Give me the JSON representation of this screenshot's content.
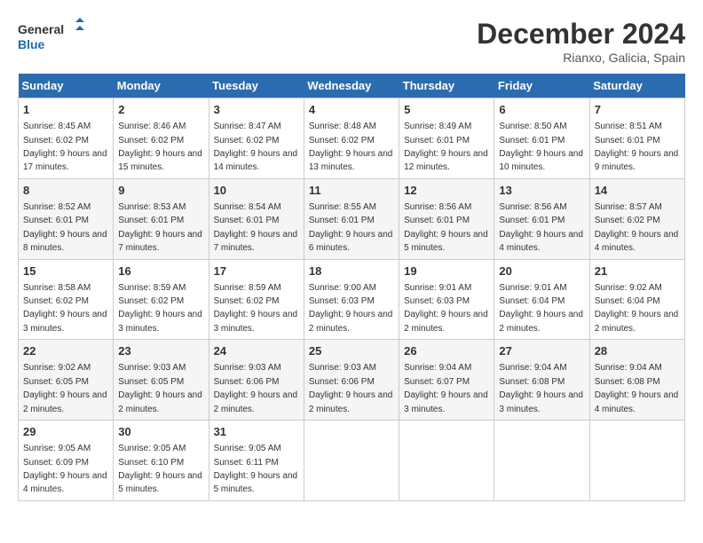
{
  "header": {
    "logo_line1": "General",
    "logo_line2": "Blue",
    "month": "December 2024",
    "location": "Rianxo, Galicia, Spain"
  },
  "weekdays": [
    "Sunday",
    "Monday",
    "Tuesday",
    "Wednesday",
    "Thursday",
    "Friday",
    "Saturday"
  ],
  "weeks": [
    [
      {
        "day": "1",
        "info": "Sunrise: 8:45 AM\nSunset: 6:02 PM\nDaylight: 9 hours and 17 minutes."
      },
      {
        "day": "2",
        "info": "Sunrise: 8:46 AM\nSunset: 6:02 PM\nDaylight: 9 hours and 15 minutes."
      },
      {
        "day": "3",
        "info": "Sunrise: 8:47 AM\nSunset: 6:02 PM\nDaylight: 9 hours and 14 minutes."
      },
      {
        "day": "4",
        "info": "Sunrise: 8:48 AM\nSunset: 6:02 PM\nDaylight: 9 hours and 13 minutes."
      },
      {
        "day": "5",
        "info": "Sunrise: 8:49 AM\nSunset: 6:01 PM\nDaylight: 9 hours and 12 minutes."
      },
      {
        "day": "6",
        "info": "Sunrise: 8:50 AM\nSunset: 6:01 PM\nDaylight: 9 hours and 10 minutes."
      },
      {
        "day": "7",
        "info": "Sunrise: 8:51 AM\nSunset: 6:01 PM\nDaylight: 9 hours and 9 minutes."
      }
    ],
    [
      {
        "day": "8",
        "info": "Sunrise: 8:52 AM\nSunset: 6:01 PM\nDaylight: 9 hours and 8 minutes."
      },
      {
        "day": "9",
        "info": "Sunrise: 8:53 AM\nSunset: 6:01 PM\nDaylight: 9 hours and 7 minutes."
      },
      {
        "day": "10",
        "info": "Sunrise: 8:54 AM\nSunset: 6:01 PM\nDaylight: 9 hours and 7 minutes."
      },
      {
        "day": "11",
        "info": "Sunrise: 8:55 AM\nSunset: 6:01 PM\nDaylight: 9 hours and 6 minutes."
      },
      {
        "day": "12",
        "info": "Sunrise: 8:56 AM\nSunset: 6:01 PM\nDaylight: 9 hours and 5 minutes."
      },
      {
        "day": "13",
        "info": "Sunrise: 8:56 AM\nSunset: 6:01 PM\nDaylight: 9 hours and 4 minutes."
      },
      {
        "day": "14",
        "info": "Sunrise: 8:57 AM\nSunset: 6:02 PM\nDaylight: 9 hours and 4 minutes."
      }
    ],
    [
      {
        "day": "15",
        "info": "Sunrise: 8:58 AM\nSunset: 6:02 PM\nDaylight: 9 hours and 3 minutes."
      },
      {
        "day": "16",
        "info": "Sunrise: 8:59 AM\nSunset: 6:02 PM\nDaylight: 9 hours and 3 minutes."
      },
      {
        "day": "17",
        "info": "Sunrise: 8:59 AM\nSunset: 6:02 PM\nDaylight: 9 hours and 3 minutes."
      },
      {
        "day": "18",
        "info": "Sunrise: 9:00 AM\nSunset: 6:03 PM\nDaylight: 9 hours and 2 minutes."
      },
      {
        "day": "19",
        "info": "Sunrise: 9:01 AM\nSunset: 6:03 PM\nDaylight: 9 hours and 2 minutes."
      },
      {
        "day": "20",
        "info": "Sunrise: 9:01 AM\nSunset: 6:04 PM\nDaylight: 9 hours and 2 minutes."
      },
      {
        "day": "21",
        "info": "Sunrise: 9:02 AM\nSunset: 6:04 PM\nDaylight: 9 hours and 2 minutes."
      }
    ],
    [
      {
        "day": "22",
        "info": "Sunrise: 9:02 AM\nSunset: 6:05 PM\nDaylight: 9 hours and 2 minutes."
      },
      {
        "day": "23",
        "info": "Sunrise: 9:03 AM\nSunset: 6:05 PM\nDaylight: 9 hours and 2 minutes."
      },
      {
        "day": "24",
        "info": "Sunrise: 9:03 AM\nSunset: 6:06 PM\nDaylight: 9 hours and 2 minutes."
      },
      {
        "day": "25",
        "info": "Sunrise: 9:03 AM\nSunset: 6:06 PM\nDaylight: 9 hours and 2 minutes."
      },
      {
        "day": "26",
        "info": "Sunrise: 9:04 AM\nSunset: 6:07 PM\nDaylight: 9 hours and 3 minutes."
      },
      {
        "day": "27",
        "info": "Sunrise: 9:04 AM\nSunset: 6:08 PM\nDaylight: 9 hours and 3 minutes."
      },
      {
        "day": "28",
        "info": "Sunrise: 9:04 AM\nSunset: 6:08 PM\nDaylight: 9 hours and 4 minutes."
      }
    ],
    [
      {
        "day": "29",
        "info": "Sunrise: 9:05 AM\nSunset: 6:09 PM\nDaylight: 9 hours and 4 minutes."
      },
      {
        "day": "30",
        "info": "Sunrise: 9:05 AM\nSunset: 6:10 PM\nDaylight: 9 hours and 5 minutes."
      },
      {
        "day": "31",
        "info": "Sunrise: 9:05 AM\nSunset: 6:11 PM\nDaylight: 9 hours and 5 minutes."
      },
      null,
      null,
      null,
      null
    ]
  ]
}
